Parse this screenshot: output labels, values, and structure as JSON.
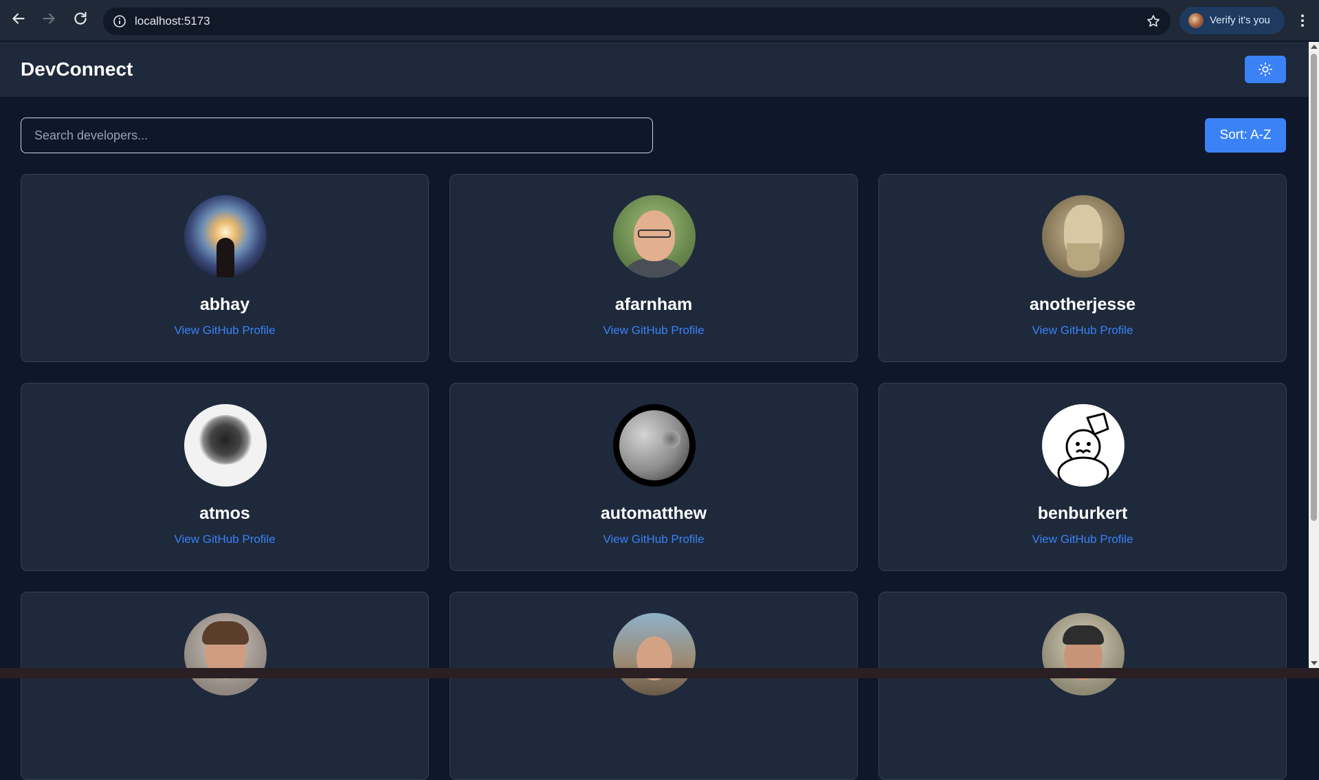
{
  "browser": {
    "url": "localhost:5173",
    "verify_label": "Verify it's you"
  },
  "app": {
    "title": "DevConnect"
  },
  "controls": {
    "search_placeholder": "Search developers...",
    "sort_label": "Sort: A-Z"
  },
  "developers": [
    {
      "username": "abhay",
      "link_label": "View GitHub Profile"
    },
    {
      "username": "afarnham",
      "link_label": "View GitHub Profile"
    },
    {
      "username": "anotherjesse",
      "link_label": "View GitHub Profile"
    },
    {
      "username": "atmos",
      "link_label": "View GitHub Profile"
    },
    {
      "username": "automatthew",
      "link_label": "View GitHub Profile"
    },
    {
      "username": "benburkert",
      "link_label": "View GitHub Profile"
    }
  ],
  "colors": {
    "accent": "#3b82f6",
    "page_bg": "#0f172a",
    "card_bg": "#1e293b"
  }
}
